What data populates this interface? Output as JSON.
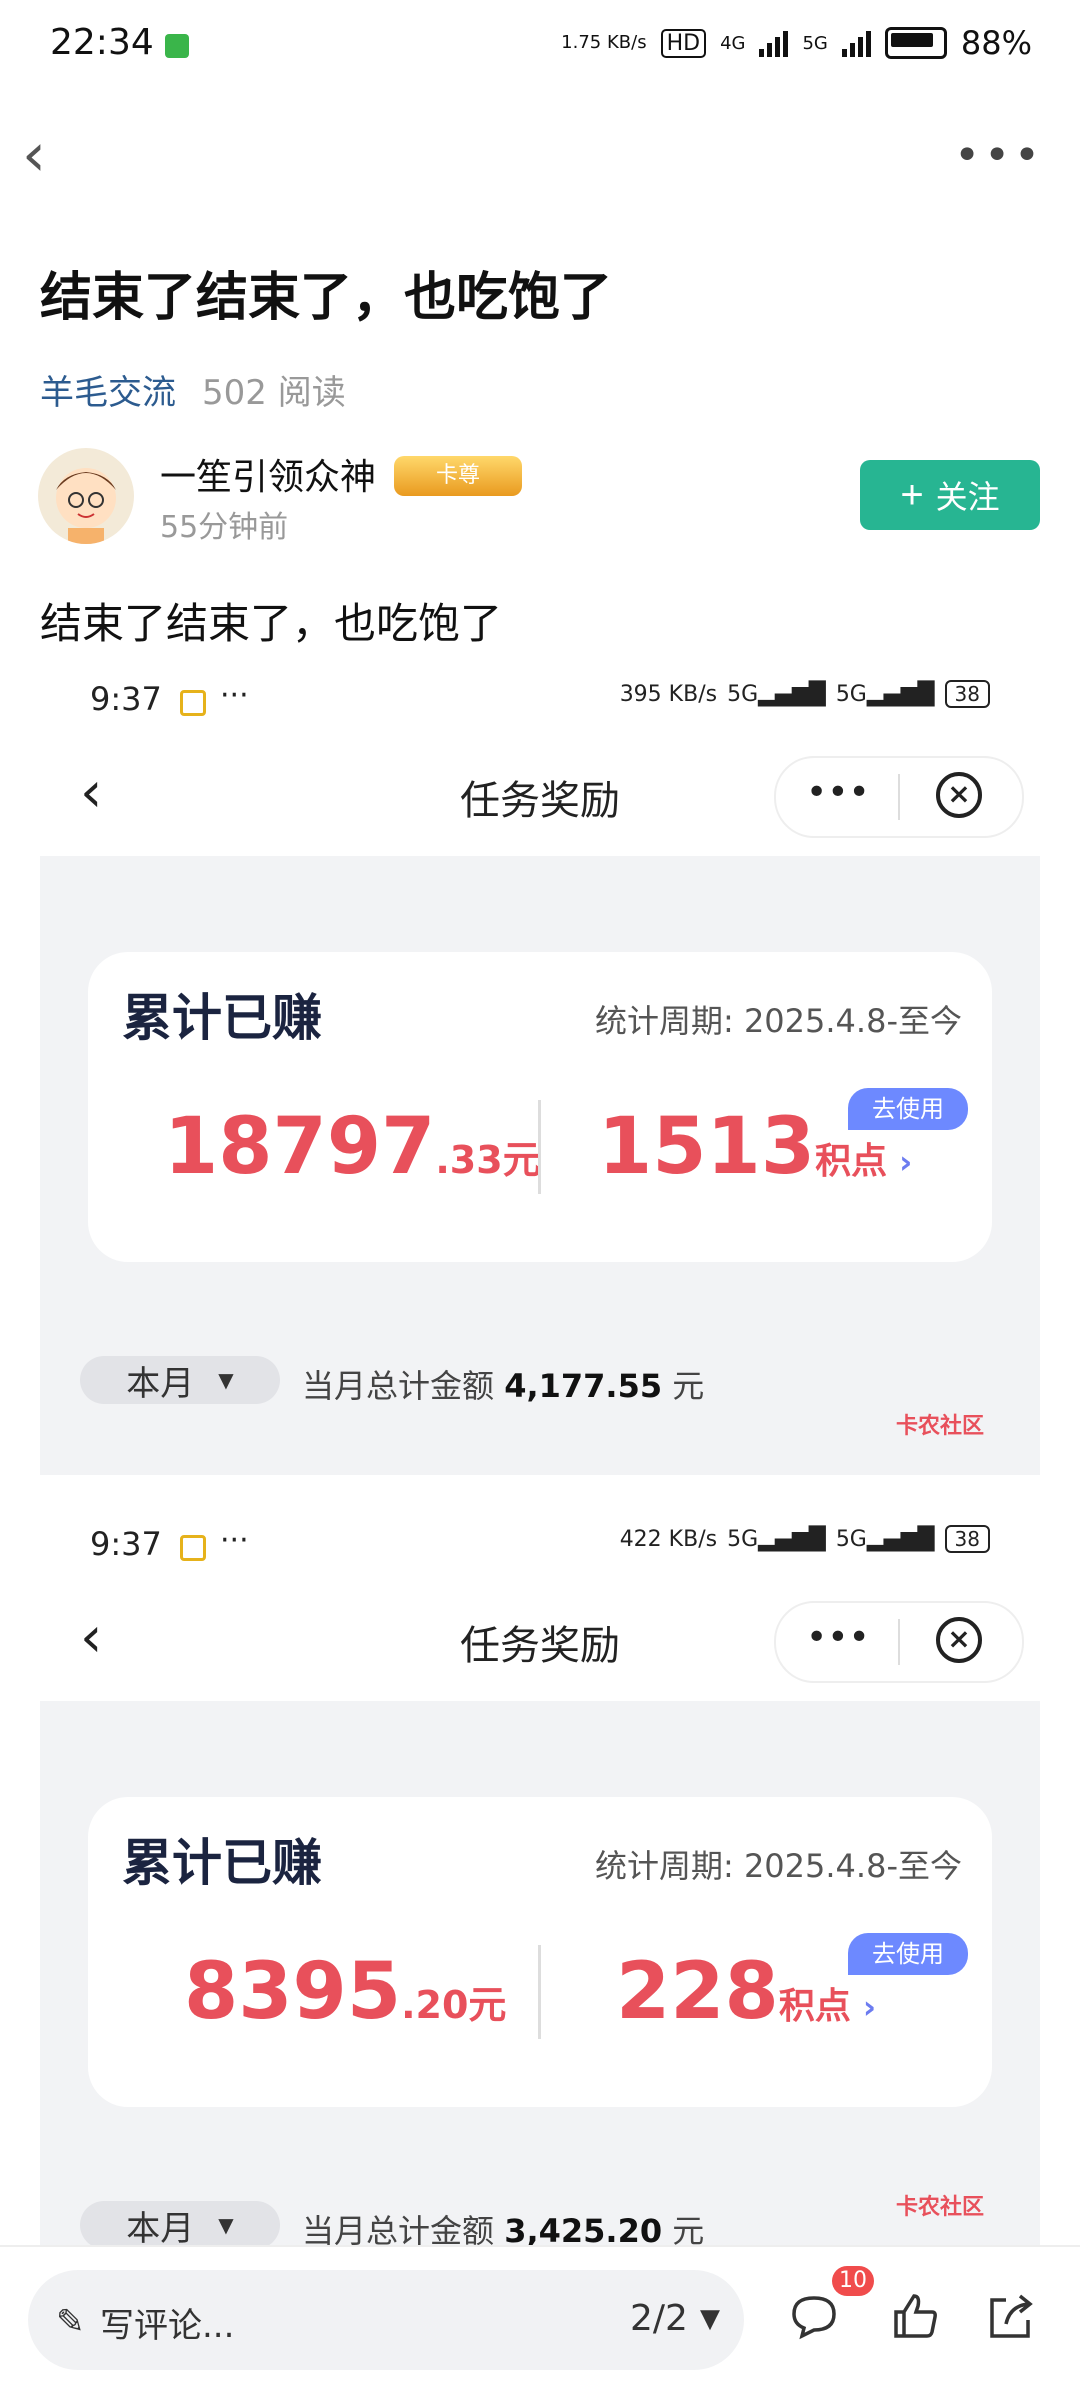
{
  "status_bar": {
    "time": "22:34",
    "net_speed": "1.75 KB/s",
    "hd": "HD",
    "net1": "4G",
    "net2": "5G",
    "battery": "88%"
  },
  "post": {
    "title": "结束了结束了，也吃饱了",
    "category": "羊毛交流",
    "reads": "502 阅读",
    "author": "一笙引领众神",
    "badge": "卡尊",
    "time": "55分钟前",
    "follow": "关注",
    "body": "结束了结束了，也吃饱了"
  },
  "shots": [
    {
      "time": "9:37",
      "speed": "395 KB/s",
      "battery": "38",
      "header_title": "任务奖励",
      "card_title": "累计已赚",
      "period": "统计周期: 2025.4.8-至今",
      "amount_int": "18797",
      "amount_dec": ".33元",
      "use": "去使用",
      "points": "1513",
      "points_unit": "积点",
      "month": "本月",
      "month_label": "当月总计金额",
      "month_amount": "4,177.55",
      "month_unit": "元",
      "watermark": "卡农社区"
    },
    {
      "time": "9:37",
      "speed": "422 KB/s",
      "battery": "38",
      "header_title": "任务奖励",
      "card_title": "累计已赚",
      "period": "统计周期: 2025.4.8-至今",
      "amount_int": "8395",
      "amount_dec": ".20元",
      "use": "去使用",
      "points": "228",
      "points_unit": "积点",
      "month": "本月",
      "month_label": "当月总计金额",
      "month_amount": "3,425.20",
      "month_unit": "元",
      "watermark": "卡农社区"
    }
  ],
  "bottom": {
    "comment_placeholder": "写评论...",
    "pager": "2/2",
    "comment_count": "10"
  }
}
